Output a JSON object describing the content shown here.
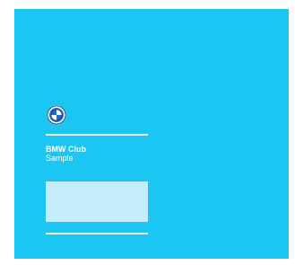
{
  "card": {
    "title": "BMW Club",
    "subtitle": "Sample",
    "logo_icon": "bmw-roundel-icon",
    "background_color": "#1cc6f2",
    "preview_box_color": "#c4ecfb"
  }
}
